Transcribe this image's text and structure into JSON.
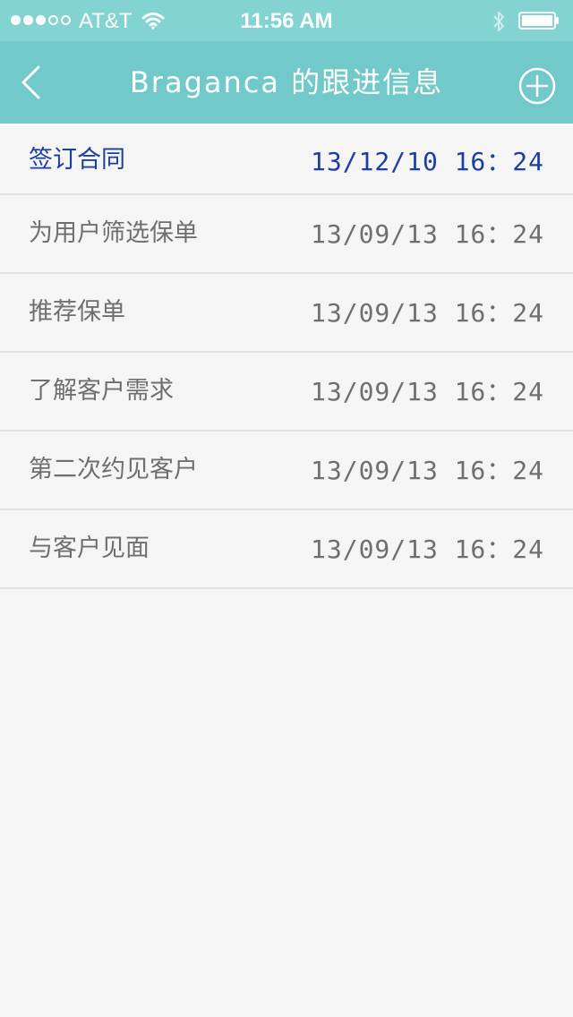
{
  "status_bar": {
    "carrier": "AT&T",
    "time": "11:56 AM",
    "signal_filled": 3,
    "signal_total": 5,
    "icons": [
      "wifi-icon",
      "bluetooth-icon",
      "battery-icon"
    ]
  },
  "nav": {
    "title": "Braganca 的跟进信息",
    "back_icon": "chevron-left-icon",
    "add_icon": "plus-circle-icon"
  },
  "records": [
    {
      "name": "签订合同",
      "date": "13/12/10",
      "time": "16：24",
      "highlight": true
    },
    {
      "name": "为用户筛选保单",
      "date": "13/09/13",
      "time": "16：24",
      "highlight": false
    },
    {
      "name": "推荐保单",
      "date": "13/09/13",
      "time": "16：24",
      "highlight": false
    },
    {
      "name": "了解客户需求",
      "date": "13/09/13",
      "time": "16：24",
      "highlight": false
    },
    {
      "name": "第二次约见客户",
      "date": "13/09/13",
      "time": "16：24",
      "highlight": false
    },
    {
      "name": "与客户见面",
      "date": "13/09/13",
      "time": "16：24",
      "highlight": false
    }
  ],
  "colors": {
    "status_bar_bg": "#84d3d3",
    "nav_bg": "#71c9c9",
    "highlight_text": "#1b3fa1",
    "normal_text": "#6f6f6f",
    "page_bg": "#f5f5f5"
  }
}
